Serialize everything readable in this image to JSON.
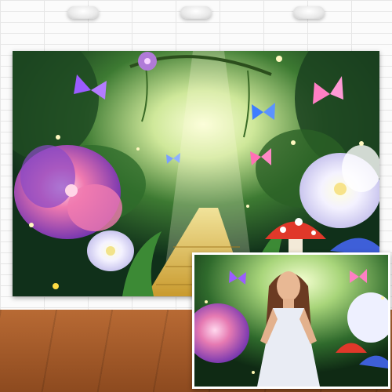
{
  "image": {
    "subject": "",
    "colors": {
      "wall": "#fbfbfb",
      "floor": "#a55a29",
      "forest_dark": "#10301a",
      "forest_light": "#cfe89a",
      "path": "#d9b64a",
      "flower_purple": "#8a4ac8",
      "flower_pink": "#f07ab0",
      "flower_white": "#f4f2ff",
      "mushroom": "#e0382a",
      "butterfly_pink": "#ff7fc4",
      "butterfly_purple": "#9b5cff",
      "butterfly_blue": "#3e7dff"
    },
    "icons": [
      "ceiling-lamp",
      "butterfly",
      "mushroom",
      "flower",
      "sparkle"
    ]
  }
}
